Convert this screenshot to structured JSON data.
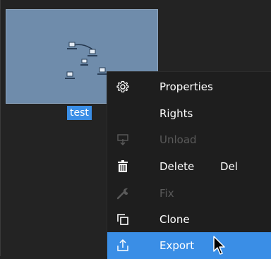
{
  "item": {
    "name": "test"
  },
  "menu": {
    "items": [
      {
        "label": "Properties",
        "icon": "gear-icon",
        "enabled": true
      },
      {
        "label": "Rights",
        "icon": "",
        "enabled": true
      },
      {
        "label": "Unload",
        "icon": "unload-icon",
        "enabled": false
      },
      {
        "label": "Delete",
        "shortcut": "Del",
        "icon": "trash-icon",
        "enabled": true
      },
      {
        "label": "Fix",
        "icon": "wrench-icon",
        "enabled": false
      },
      {
        "label": "Clone",
        "icon": "clone-icon",
        "enabled": true
      },
      {
        "label": "Export",
        "icon": "export-icon",
        "enabled": true,
        "highlighted": true
      }
    ]
  },
  "colors": {
    "background": "#232323",
    "menu_background": "#1e1e1e",
    "highlight": "#3a8ee6",
    "thumbnail": "#6f8cab",
    "disabled_text": "#5a5a5a"
  }
}
